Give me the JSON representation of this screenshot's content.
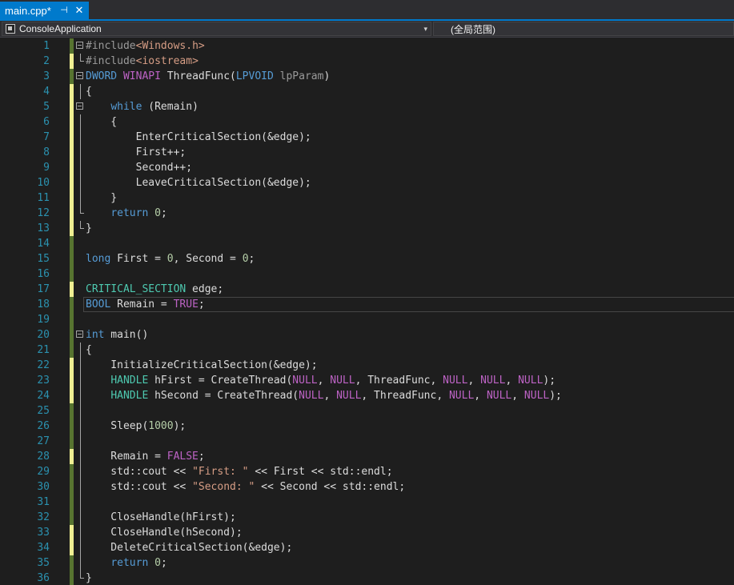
{
  "tab": {
    "title": "main.cpp*",
    "pin_glyph": "⊣",
    "close_glyph": "✕",
    "accent": "#007acc"
  },
  "navbar": {
    "project": "ConsoleApplication",
    "scope": "(全局范围)",
    "dropdown_glyph": "▾"
  },
  "editor": {
    "current_line": 18,
    "lines": [
      {
        "n": "1",
        "chg": "green",
        "fold": true,
        "tokens": [
          [
            "pp",
            "#include"
          ],
          [
            "inc",
            "<Windows.h>"
          ]
        ]
      },
      {
        "n": "2",
        "chg": "yellow",
        "guide_end": true,
        "tokens": [
          [
            "pp",
            "#include"
          ],
          [
            "inc",
            "<iostream>"
          ]
        ]
      },
      {
        "n": "3",
        "chg": "green",
        "fold": true,
        "tokens": [
          [
            "kw",
            "DWORD"
          ],
          [
            "plain",
            " "
          ],
          [
            "mac",
            "WINAPI"
          ],
          [
            "plain",
            " ThreadFunc("
          ],
          [
            "kw",
            "LPVOID"
          ],
          [
            "plain",
            " "
          ],
          [
            "param",
            "lpParam"
          ],
          [
            "plain",
            ")"
          ]
        ]
      },
      {
        "n": "4",
        "chg": "yellow",
        "guide": true,
        "tokens": [
          [
            "plain",
            "{"
          ]
        ]
      },
      {
        "n": "5",
        "chg": "yellow",
        "fold": true,
        "tokens": [
          [
            "plain",
            "    "
          ],
          [
            "kw",
            "while"
          ],
          [
            "plain",
            " (Remain)"
          ]
        ]
      },
      {
        "n": "6",
        "chg": "yellow",
        "guide": true,
        "tokens": [
          [
            "plain",
            "    {"
          ]
        ]
      },
      {
        "n": "7",
        "chg": "yellow",
        "guide": true,
        "tokens": [
          [
            "plain",
            "        EnterCriticalSection(&edge);"
          ]
        ]
      },
      {
        "n": "8",
        "chg": "yellow",
        "guide": true,
        "tokens": [
          [
            "plain",
            "        First++;"
          ]
        ]
      },
      {
        "n": "9",
        "chg": "yellow",
        "guide": true,
        "tokens": [
          [
            "plain",
            "        Second++;"
          ]
        ]
      },
      {
        "n": "10",
        "chg": "yellow",
        "guide": true,
        "tokens": [
          [
            "plain",
            "        LeaveCriticalSection(&edge);"
          ]
        ]
      },
      {
        "n": "11",
        "chg": "yellow",
        "guide": true,
        "tokens": [
          [
            "plain",
            "    }"
          ]
        ]
      },
      {
        "n": "12",
        "chg": "yellow",
        "guide_end": true,
        "tokens": [
          [
            "plain",
            "    "
          ],
          [
            "kw",
            "return"
          ],
          [
            "plain",
            " "
          ],
          [
            "num",
            "0"
          ],
          [
            "plain",
            ";"
          ]
        ]
      },
      {
        "n": "13",
        "chg": "yellow",
        "guide_end": true,
        "tokens": [
          [
            "plain",
            "}"
          ]
        ]
      },
      {
        "n": "14",
        "chg": "green",
        "tokens": []
      },
      {
        "n": "15",
        "chg": "green",
        "tokens": [
          [
            "kw",
            "long"
          ],
          [
            "plain",
            " First = "
          ],
          [
            "num",
            "0"
          ],
          [
            "plain",
            ", Second = "
          ],
          [
            "num",
            "0"
          ],
          [
            "plain",
            ";"
          ]
        ]
      },
      {
        "n": "16",
        "chg": "green",
        "tokens": []
      },
      {
        "n": "17",
        "chg": "yellow",
        "tokens": [
          [
            "type",
            "CRITICAL_SECTION"
          ],
          [
            "plain",
            " edge;"
          ]
        ]
      },
      {
        "n": "18",
        "chg": "green",
        "tokens": [
          [
            "kw",
            "BOOL"
          ],
          [
            "plain",
            " Remain = "
          ],
          [
            "mac",
            "TRUE"
          ],
          [
            "plain",
            ";"
          ]
        ]
      },
      {
        "n": "19",
        "chg": "green",
        "tokens": []
      },
      {
        "n": "20",
        "chg": "green",
        "fold": true,
        "tokens": [
          [
            "kw",
            "int"
          ],
          [
            "plain",
            " main()"
          ]
        ]
      },
      {
        "n": "21",
        "chg": "green",
        "guide": true,
        "tokens": [
          [
            "plain",
            "{"
          ]
        ]
      },
      {
        "n": "22",
        "chg": "yellow",
        "guide": true,
        "tokens": [
          [
            "plain",
            "    InitializeCriticalSection(&edge);"
          ]
        ]
      },
      {
        "n": "23",
        "chg": "yellow",
        "guide": true,
        "tokens": [
          [
            "plain",
            "    "
          ],
          [
            "type",
            "HANDLE"
          ],
          [
            "plain",
            " hFirst = CreateThread("
          ],
          [
            "mac",
            "NULL"
          ],
          [
            "plain",
            ", "
          ],
          [
            "mac",
            "NULL"
          ],
          [
            "plain",
            ", ThreadFunc, "
          ],
          [
            "mac",
            "NULL"
          ],
          [
            "plain",
            ", "
          ],
          [
            "mac",
            "NULL"
          ],
          [
            "plain",
            ", "
          ],
          [
            "mac",
            "NULL"
          ],
          [
            "plain",
            ");"
          ]
        ]
      },
      {
        "n": "24",
        "chg": "yellow",
        "guide": true,
        "tokens": [
          [
            "plain",
            "    "
          ],
          [
            "type",
            "HANDLE"
          ],
          [
            "plain",
            " hSecond = CreateThread("
          ],
          [
            "mac",
            "NULL"
          ],
          [
            "plain",
            ", "
          ],
          [
            "mac",
            "NULL"
          ],
          [
            "plain",
            ", ThreadFunc, "
          ],
          [
            "mac",
            "NULL"
          ],
          [
            "plain",
            ", "
          ],
          [
            "mac",
            "NULL"
          ],
          [
            "plain",
            ", "
          ],
          [
            "mac",
            "NULL"
          ],
          [
            "plain",
            ");"
          ]
        ]
      },
      {
        "n": "25",
        "chg": "green",
        "guide": true,
        "tokens": []
      },
      {
        "n": "26",
        "chg": "green",
        "guide": true,
        "tokens": [
          [
            "plain",
            "    Sleep("
          ],
          [
            "num",
            "1000"
          ],
          [
            "plain",
            ");"
          ]
        ]
      },
      {
        "n": "27",
        "chg": "green",
        "guide": true,
        "tokens": []
      },
      {
        "n": "28",
        "chg": "yellow",
        "guide": true,
        "tokens": [
          [
            "plain",
            "    Remain = "
          ],
          [
            "mac",
            "FALSE"
          ],
          [
            "plain",
            ";"
          ]
        ]
      },
      {
        "n": "29",
        "chg": "green",
        "guide": true,
        "tokens": [
          [
            "plain",
            "    std::cout << "
          ],
          [
            "str",
            "\"First: \""
          ],
          [
            "plain",
            " << First << std::endl;"
          ]
        ]
      },
      {
        "n": "30",
        "chg": "green",
        "guide": true,
        "tokens": [
          [
            "plain",
            "    std::cout << "
          ],
          [
            "str",
            "\"Second: \""
          ],
          [
            "plain",
            " << Second << std::endl;"
          ]
        ]
      },
      {
        "n": "31",
        "chg": "green",
        "guide": true,
        "tokens": []
      },
      {
        "n": "32",
        "chg": "green",
        "guide": true,
        "tokens": [
          [
            "plain",
            "    CloseHandle(hFirst);"
          ]
        ]
      },
      {
        "n": "33",
        "chg": "yellow",
        "guide": true,
        "tokens": [
          [
            "plain",
            "    CloseHandle(hSecond);"
          ]
        ]
      },
      {
        "n": "34",
        "chg": "yellow",
        "guide": true,
        "tokens": [
          [
            "plain",
            "    DeleteCriticalSection(&edge);"
          ]
        ]
      },
      {
        "n": "35",
        "chg": "green",
        "guide": true,
        "tokens": [
          [
            "plain",
            "    "
          ],
          [
            "kw",
            "return"
          ],
          [
            "plain",
            " "
          ],
          [
            "num",
            "0"
          ],
          [
            "plain",
            ";"
          ]
        ]
      },
      {
        "n": "36",
        "chg": "green",
        "guide_end": true,
        "tokens": [
          [
            "plain",
            "}"
          ]
        ]
      }
    ]
  }
}
